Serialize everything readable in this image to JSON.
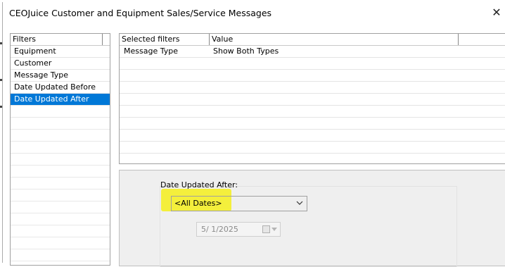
{
  "window": {
    "title": "CEOJuice Customer and Equipment Sales/Service Messages",
    "close_symbol": "✕"
  },
  "filters": {
    "header": "Filters",
    "items": [
      {
        "label": "Equipment",
        "selected": false
      },
      {
        "label": "Customer",
        "selected": false
      },
      {
        "label": "Message Type",
        "selected": false
      },
      {
        "label": "Date Updated Before",
        "selected": false
      },
      {
        "label": "Date Updated After",
        "selected": true
      }
    ]
  },
  "selected_filters": {
    "columns": [
      "Selected filters",
      "Value"
    ],
    "rows": [
      {
        "filter": "Message Type",
        "value": "Show Both Types"
      }
    ]
  },
  "options": {
    "label": "Date Updated After:",
    "combo_value": "<All Dates>",
    "date_value": "5/  1/2025",
    "highlight_color": "#f4ee1c",
    "selection_color": "#0078d7"
  },
  "icons": {
    "close": "close-icon",
    "dropdown": "chevron-down-icon",
    "calendar": "calendar-icon"
  }
}
